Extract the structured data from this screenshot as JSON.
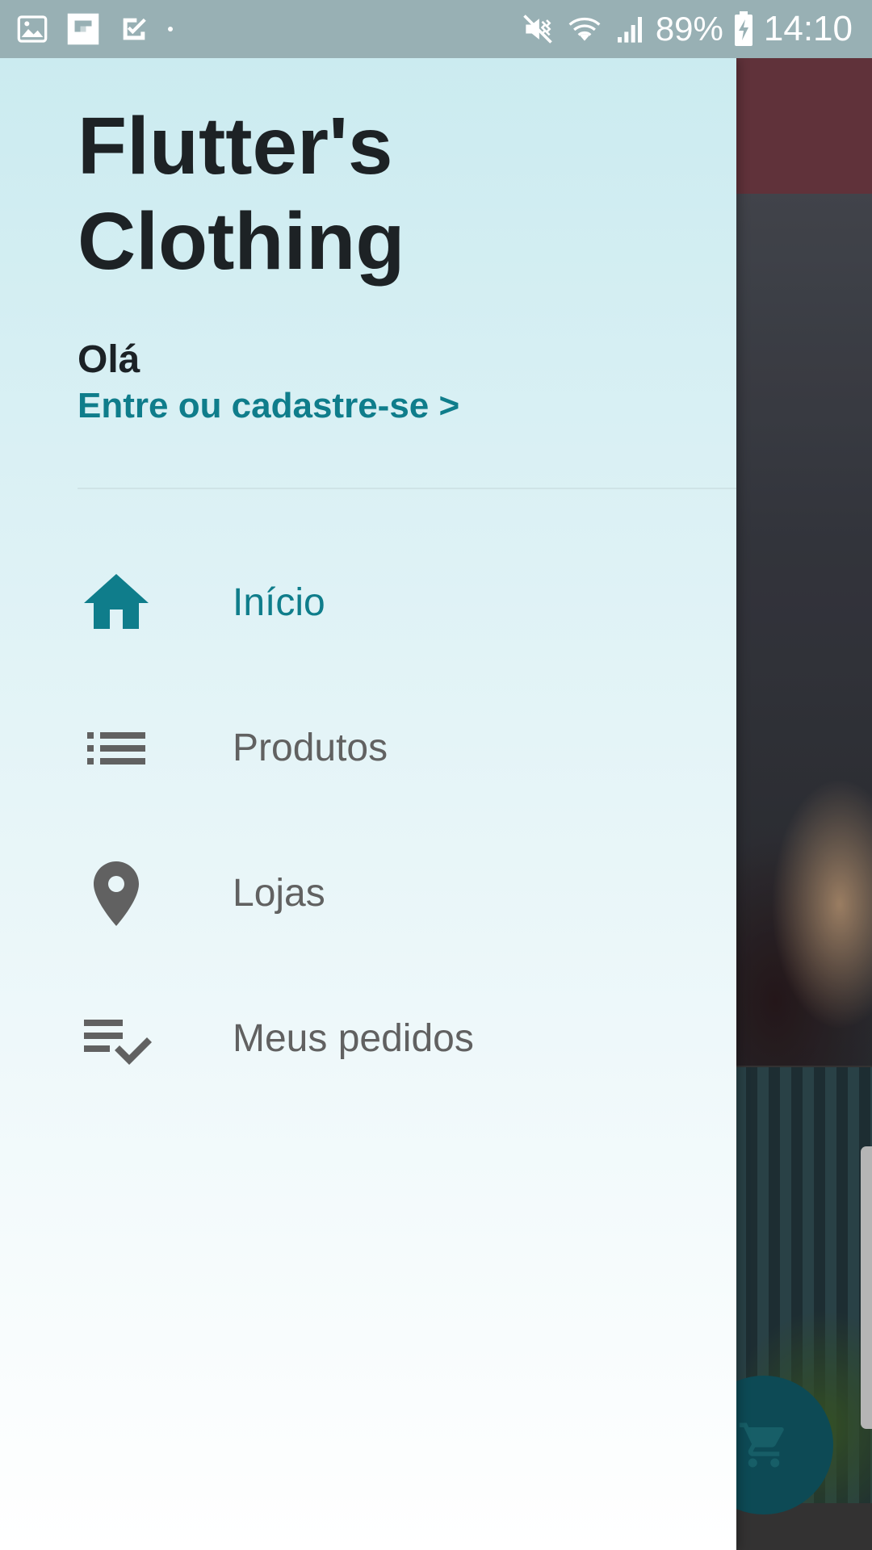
{
  "status_bar": {
    "icons_left": [
      "gallery-icon",
      "flipboard-icon",
      "task-check-icon",
      "dot-icon"
    ],
    "icons_right": [
      "mute-icon",
      "wifi-icon",
      "signal-icon",
      "battery-icon"
    ],
    "battery": "89%",
    "time": "14:10"
  },
  "drawer": {
    "title_line1": "Flutter's",
    "title_line2": "Clothing",
    "greeting": "Olá",
    "login_link": "Entre ou cadastre-se >",
    "menu": [
      {
        "label": "Início",
        "icon": "home-icon",
        "active": true
      },
      {
        "label": "Produtos",
        "icon": "list-icon",
        "active": false
      },
      {
        "label": "Lojas",
        "icon": "location-pin-icon",
        "active": false
      },
      {
        "label": "Meus pedidos",
        "icon": "playlist-check-icon",
        "active": false
      }
    ]
  },
  "colors": {
    "accent": "#0f7d8b",
    "inactive": "#616161",
    "title": "#1d2225",
    "status_bar": "#98b0b4",
    "fab": "#0f5561"
  },
  "fab": {
    "icon": "cart-icon"
  }
}
